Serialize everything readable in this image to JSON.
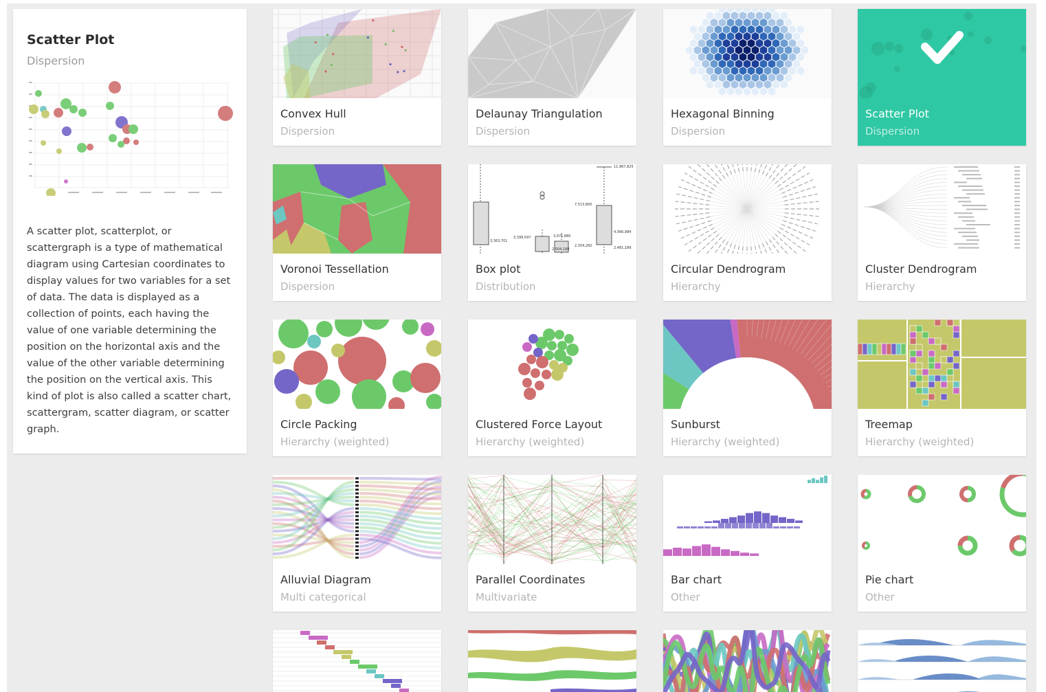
{
  "info": {
    "title": "Scatter Plot",
    "category": "Dispersion",
    "description": "A scatter plot, scatterplot, or scattergraph is a type of mathematical diagram using Cartesian coordinates to display values for two variables for a set of data. The data is displayed as a collection of points, each having the value of one variable determining the position on the horizontal axis and the value of the other variable determining the position on the vertical axis. This kind of plot is also called a scatter chart, scattergram, scatter diagram, or scatter graph."
  },
  "cards": [
    {
      "title": "Convex Hull",
      "category": "Dispersion",
      "thumb": "convex"
    },
    {
      "title": "Delaunay Triangulation",
      "category": "Dispersion",
      "thumb": "delaunay"
    },
    {
      "title": "Hexagonal Binning",
      "category": "Dispersion",
      "thumb": "hexbin"
    },
    {
      "title": "Scatter Plot",
      "category": "Dispersion",
      "thumb": "selected",
      "selected": true
    },
    {
      "title": "Voronoi Tessellation",
      "category": "Dispersion",
      "thumb": "voronoi"
    },
    {
      "title": "Box plot",
      "category": "Distribution",
      "thumb": "boxplot"
    },
    {
      "title": "Circular Dendrogram",
      "category": "Hierarchy",
      "thumb": "circdendro"
    },
    {
      "title": "Cluster Dendrogram",
      "category": "Hierarchy",
      "thumb": "clusterdendro"
    },
    {
      "title": "Circle Packing",
      "category": "Hierarchy (weighted)",
      "thumb": "circlepack"
    },
    {
      "title": "Clustered Force Layout",
      "category": "Hierarchy (weighted)",
      "thumb": "force"
    },
    {
      "title": "Sunburst",
      "category": "Hierarchy (weighted)",
      "thumb": "sunburst"
    },
    {
      "title": "Treemap",
      "category": "Hierarchy (weighted)",
      "thumb": "treemap"
    },
    {
      "title": "Alluvial Diagram",
      "category": "Multi categorical",
      "thumb": "alluvial"
    },
    {
      "title": "Parallel Coordinates",
      "category": "Multivariate",
      "thumb": "parallel"
    },
    {
      "title": "Bar chart",
      "category": "Other",
      "thumb": "barchart"
    },
    {
      "title": "Pie chart",
      "category": "Other",
      "thumb": "piechart"
    },
    {
      "title": "",
      "category": "",
      "thumb": "gantt"
    },
    {
      "title": "",
      "category": "",
      "thumb": "stream"
    },
    {
      "title": "",
      "category": "",
      "thumb": "bump"
    },
    {
      "title": "",
      "category": "",
      "thumb": "horizon"
    }
  ],
  "boxplot_labels": [
    "11,967,825",
    "7,513,800",
    "4,366,984",
    "3,363,701",
    "3,399,597",
    "3,971,880",
    "2,504,180",
    "2,354,282",
    "2,481,189"
  ],
  "icons": {
    "selected": "check-icon"
  },
  "colors": {
    "green": "#6cc96a",
    "red": "#cf6f6f",
    "purple": "#7466c8",
    "olive": "#c4c86a",
    "teal": "#6cc6c2",
    "magenta": "#c86ac4",
    "accent": "#2fc8a4",
    "blue": "#2a5db0"
  }
}
